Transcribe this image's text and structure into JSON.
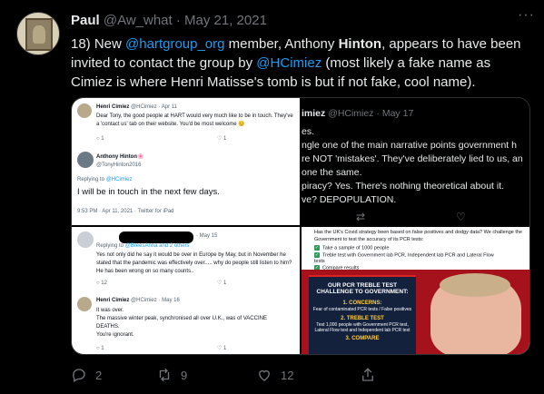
{
  "tweet": {
    "author_name": "Paul",
    "handle": "@Aw_what",
    "separator": " · ",
    "date": "May 21, 2021",
    "text_prefix": "18) New ",
    "mention_1": "@hartgroup_org",
    "text_mid_1": " member, Anthony ",
    "name_bold": "Hinton",
    "text_mid_2": ", appears to have been invited to contact the group by ",
    "mention_2": "@HCimiez",
    "text_suffix": " (most likely a fake name as Cimiez is where Henri Matisse's tomb is but if not fake, cool name)."
  },
  "image1": {
    "author": "Henri Cimiez",
    "meta": "@HCimiez · Apr 11",
    "text": "Dear Tony, the good people at HART would very much like to be in touch. They've a 'contact us' tab on their website. You'd be most welcome 😊",
    "reply_count": "1",
    "like_count": "1",
    "reply_author": "Anthony Hinton🌸",
    "reply_handle": "@TonyHinton2016",
    "replying_label": "Replying to ",
    "replying_to": "@HCimiez",
    "reply_text": "I will be in touch in the next few days.",
    "reply_footer": "9:53 PM · Apr 11, 2021 · Twitter for iPad"
  },
  "image2": {
    "header_name": "imiez",
    "header_meta": "@HCimiez · May 17",
    "lines": [
      "es.",
      "ngle one of the main narrative points government h",
      "re NOT 'mistakes'. They've deliberately lied to us, an",
      "one the same.",
      "piracy?  Yes. There's nothing theoretical about it.",
      "ve? DEPOPULATION."
    ]
  },
  "image3": {
    "meta": "· May 15",
    "replying_label": "Replying to ",
    "replying_to": "@BreesAnna and 2 others",
    "text": "Yes not only did he say it would be over in Europe by May, but in November he stated that the pandemic was effectively over..... why do people still listen to him? He has been wrong on so many counts..",
    "reply_count": "12",
    "like_count": "1",
    "author_2": "Henri Cimiez",
    "meta_2": "@HCimiez · May 16",
    "text_2a": "It was over.",
    "text_2b": "The massive winter peak, synchronised all over U.K., was of VACCINE DEATHS.",
    "text_2c": "You're ignorant.",
    "reply_count_2": "1",
    "like_count_2": "1"
  },
  "image4": {
    "intro": "Has the UK's Covid strategy been based on false positives and dodgy data? We challenge the Government to test the accuracy of its PCR tests:",
    "items": [
      "Take a sample of 1000 people",
      "Treble test with Government lab PCR, Independent lab PCR and Lateral Flow tests",
      "Compare results"
    ],
    "poster_title": "OUR PCR TREBLE TEST CHALLENGE TO GOVERNMENT:",
    "poster_step1": "1. CONCERNS:",
    "poster_step1_text": "Fear of contaminated PCR tests / False positives",
    "poster_step2": "2. TREBLE TEST",
    "poster_step2_text": "Test 1,000 people with Government PCR test, Lateral Flow test and Independent lab PCR test",
    "poster_step3": "3. COMPARE"
  },
  "actions": {
    "reply_count": "2",
    "retweet_count": "9",
    "like_count": "12"
  },
  "colors": {
    "background": "#000000",
    "text": "#e7e9ea",
    "muted": "#71767b",
    "link": "#1d9bf0"
  }
}
